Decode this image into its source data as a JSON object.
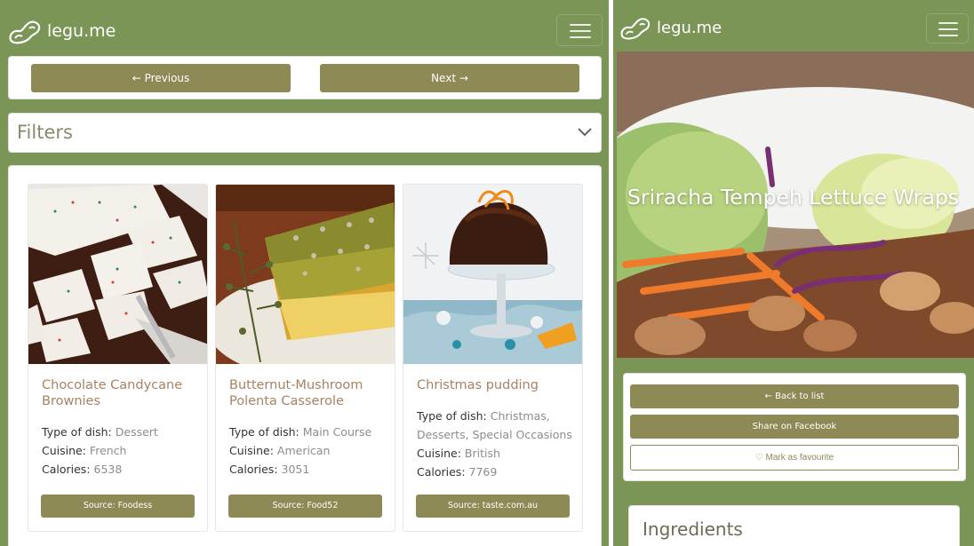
{
  "brand": {
    "name": "legu.me"
  },
  "colors": {
    "navbar": "#7a9556",
    "button": "#8e8a56",
    "recipe_title": "#a78362"
  },
  "left": {
    "pagination": {
      "previous_label": "← Previous",
      "next_label": "Next →"
    },
    "filters": {
      "title": "Filters",
      "toggle_icon": "chevron-down-icon"
    },
    "recipes": [
      {
        "title": "Chocolate Candycane Brownies",
        "type_label": "Type of dish:",
        "type_value": "Dessert",
        "cuisine_label": "Cuisine:",
        "cuisine_value": "French",
        "calories_label": "Calories:",
        "calories_value": "6538",
        "source_label": "Source: Foodess"
      },
      {
        "title": "Butternut-Mushroom Polenta Casserole",
        "type_label": "Type of dish:",
        "type_value": "Main Course",
        "cuisine_label": "Cuisine:",
        "cuisine_value": "American",
        "calories_label": "Calories:",
        "calories_value": "3051",
        "source_label": "Source: Food52"
      },
      {
        "title": "Christmas pudding",
        "type_label": "Type of dish:",
        "type_value": "Christmas, Desserts, Special Occasions",
        "cuisine_label": "Cuisine:",
        "cuisine_value": "British",
        "calories_label": "Calories:",
        "calories_value": "7769",
        "source_label": "Source: taste.com.au"
      }
    ]
  },
  "right": {
    "recipe_title": "Sriracha Tempeh Lettuce Wraps",
    "actions": {
      "back_label": "← Back to list",
      "share_label": "Share on Facebook",
      "favourite_label": "♡ Mark as favourite"
    },
    "ingredients_title": "Ingredients"
  }
}
